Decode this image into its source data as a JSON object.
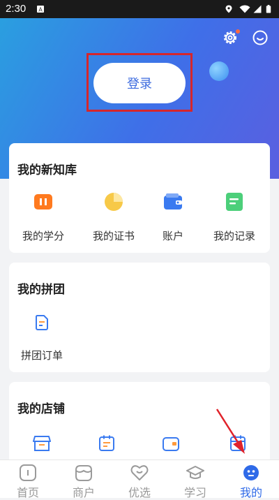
{
  "status_bar": {
    "time": "2:30"
  },
  "header": {
    "login_label": "登录"
  },
  "section_library": {
    "title": "我的新知库",
    "items": [
      {
        "label": "我的学分",
        "icon": "credits-icon"
      },
      {
        "label": "我的证书",
        "icon": "certificate-icon"
      },
      {
        "label": "账户",
        "icon": "wallet-icon"
      },
      {
        "label": "我的记录",
        "icon": "record-icon"
      }
    ]
  },
  "section_group": {
    "title": "我的拼团",
    "items": [
      {
        "label": "拼团订单",
        "icon": "group-order-icon"
      }
    ]
  },
  "section_shop": {
    "title": "我的店铺",
    "items": [
      {
        "icon": "store-icon"
      },
      {
        "icon": "calendar-list-icon"
      },
      {
        "icon": "wallet-card-icon"
      },
      {
        "icon": "calendar-icon"
      }
    ]
  },
  "bottom_nav": {
    "items": [
      {
        "label": "首页",
        "icon": "home-icon"
      },
      {
        "label": "商户",
        "icon": "merchant-icon"
      },
      {
        "label": "优选",
        "icon": "heart-icon"
      },
      {
        "label": "学习",
        "icon": "graduation-cap-icon"
      },
      {
        "label": "我的",
        "icon": "profile-icon"
      }
    ],
    "active_index": 4
  },
  "colors": {
    "accent": "#2f6ae8",
    "highlight": "#d6262b",
    "gradient_start": "#2a9fe0",
    "gradient_end": "#5a5fe0"
  }
}
